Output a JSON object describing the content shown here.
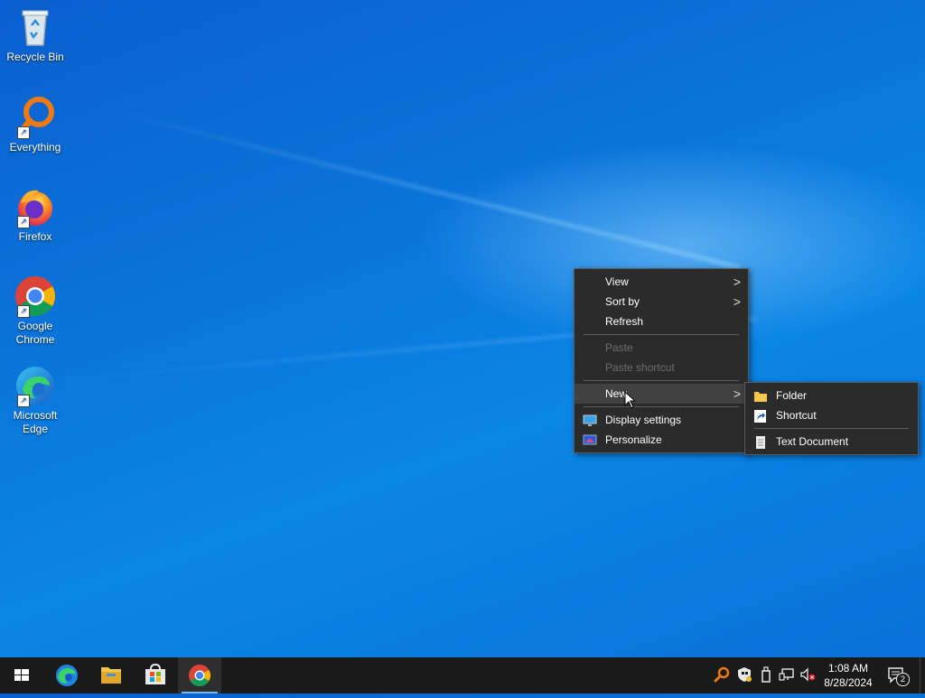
{
  "desktop": {
    "icons": [
      {
        "label": "Recycle Bin",
        "icon": "recycle-bin-icon"
      },
      {
        "label": "Everything",
        "icon": "everything-search-icon"
      },
      {
        "label": "Firefox",
        "icon": "firefox-icon"
      },
      {
        "label": "Google Chrome",
        "label_line1": "Google",
        "label_line2": "Chrome",
        "icon": "chrome-icon"
      },
      {
        "label": "Microsoft Edge",
        "label_line1": "Microsoft",
        "label_line2": "Edge",
        "icon": "edge-icon"
      }
    ]
  },
  "context_menu": {
    "items": [
      {
        "label": "View",
        "submenu": true,
        "enabled": true
      },
      {
        "label": "Sort by",
        "submenu": true,
        "enabled": true
      },
      {
        "label": "Refresh",
        "enabled": true
      },
      {
        "label": "Paste",
        "enabled": false
      },
      {
        "label": "Paste shortcut",
        "enabled": false
      },
      {
        "label": "New",
        "submenu": true,
        "enabled": true,
        "highlighted": true
      },
      {
        "label": "Display settings",
        "icon": "display-settings-icon",
        "enabled": true
      },
      {
        "label": "Personalize",
        "icon": "personalize-icon",
        "enabled": true
      }
    ]
  },
  "new_submenu": {
    "items": [
      {
        "label": "Folder",
        "icon": "folder-icon"
      },
      {
        "label": "Shortcut",
        "icon": "shortcut-icon"
      },
      {
        "label": "Text Document",
        "icon": "text-document-icon"
      }
    ]
  },
  "taskbar": {
    "pinned": [
      {
        "name": "start",
        "icon": "windows-start-icon"
      },
      {
        "name": "edge",
        "icon": "edge-icon"
      },
      {
        "name": "file-explorer",
        "icon": "file-explorer-icon"
      },
      {
        "name": "store",
        "icon": "microsoft-store-icon"
      },
      {
        "name": "chrome",
        "icon": "chrome-icon",
        "active": true
      }
    ],
    "tray_icons": [
      "everything-search-icon",
      "windows-security-icon",
      "usb-device-icon",
      "network-icon",
      "volume-muted-icon"
    ],
    "clock": {
      "time": "1:08 AM",
      "date": "8/28/2024"
    },
    "notifications": {
      "count": "2"
    }
  },
  "colors": {
    "menu_bg": "#2b2b2b",
    "menu_hover": "#414141",
    "taskbar_bg": "#1a1a1a",
    "chrome_indicator": "#76b9ed"
  }
}
